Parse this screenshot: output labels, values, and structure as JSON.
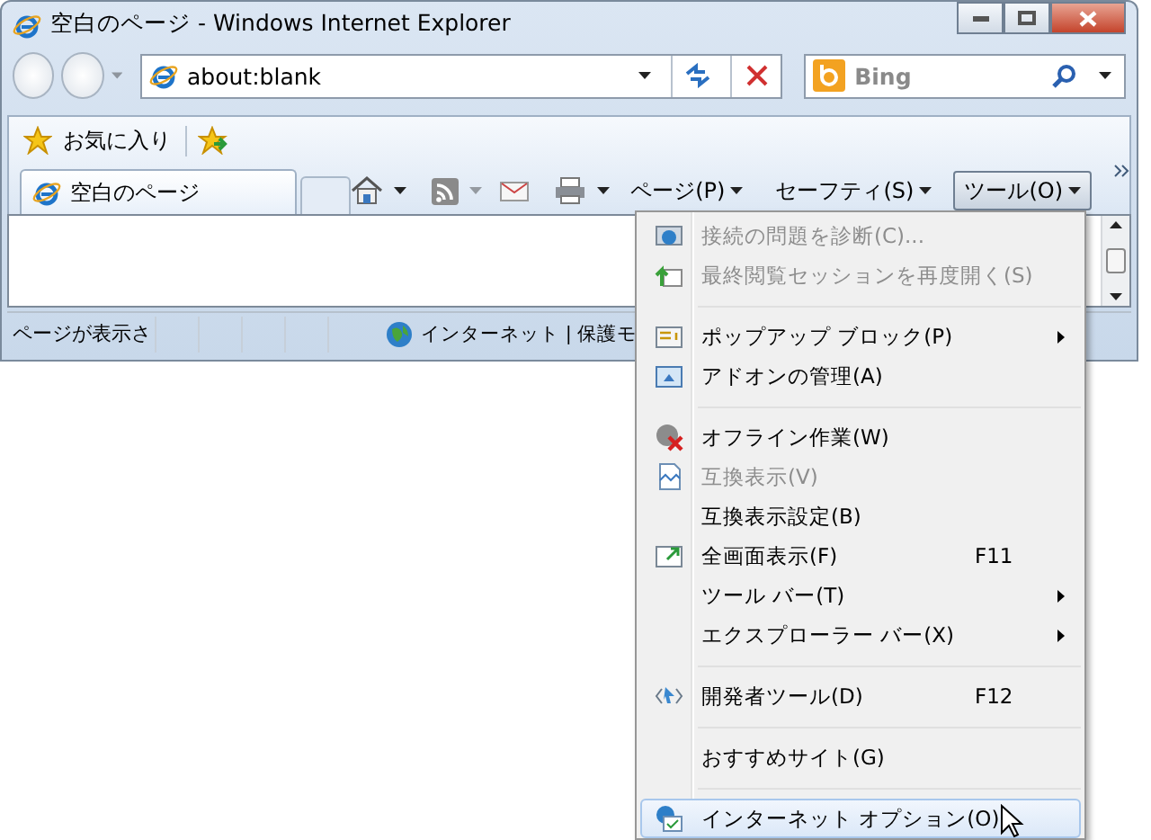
{
  "window": {
    "title": "空白のページ - Windows Internet Explorer"
  },
  "address_bar": {
    "value": "about:blank"
  },
  "search": {
    "placeholder": "Bing"
  },
  "favorites_bar": {
    "label": "お気に入り"
  },
  "tabs": [
    {
      "label": "空白のページ",
      "selected": true
    }
  ],
  "command_bar": [
    {
      "label": "ページ(P)",
      "selected": false
    },
    {
      "label": "セーフティ(S)",
      "selected": false
    },
    {
      "label": "ツール(O)",
      "selected": true
    }
  ],
  "status_bar": {
    "text": "ページが表示さ",
    "zone": "インターネット | 保護モ"
  },
  "menu": {
    "items": [
      {
        "kind": "item",
        "label": "接続の問題を診断(C)...",
        "disabled": true,
        "selected": false,
        "submenu": false
      },
      {
        "kind": "item",
        "label": "最終閲覧セッションを再度開く(S)",
        "disabled": true,
        "selected": false,
        "submenu": false
      },
      {
        "kind": "separator"
      },
      {
        "kind": "item",
        "label": "ポップアップ ブロック(P)",
        "disabled": false,
        "selected": false,
        "submenu": true
      },
      {
        "kind": "item",
        "label": "アドオンの管理(A)",
        "disabled": false,
        "selected": false,
        "submenu": false
      },
      {
        "kind": "separator"
      },
      {
        "kind": "item",
        "label": "オフライン作業(W)",
        "disabled": false,
        "selected": false,
        "submenu": false
      },
      {
        "kind": "item",
        "label": "互換表示(V)",
        "disabled": true,
        "selected": false,
        "submenu": false
      },
      {
        "kind": "item",
        "label": "互換表示設定(B)",
        "disabled": false,
        "selected": false,
        "submenu": false
      },
      {
        "kind": "item",
        "label": "全画面表示(F)",
        "shortcut": "F11",
        "disabled": false,
        "selected": false,
        "submenu": false
      },
      {
        "kind": "item",
        "label": "ツール バー(T)",
        "disabled": false,
        "selected": false,
        "submenu": true
      },
      {
        "kind": "item",
        "label": "エクスプローラー バー(X)",
        "disabled": false,
        "selected": false,
        "submenu": true
      },
      {
        "kind": "separator"
      },
      {
        "kind": "item",
        "label": "開発者ツール(D)",
        "shortcut": "F12",
        "disabled": false,
        "selected": false,
        "submenu": false
      },
      {
        "kind": "separator"
      },
      {
        "kind": "item",
        "label": "おすすめサイト(G)",
        "disabled": false,
        "selected": false,
        "submenu": false
      },
      {
        "kind": "separator"
      },
      {
        "kind": "item",
        "label": "インターネット オプション(O)",
        "disabled": false,
        "selected": true,
        "submenu": false
      }
    ]
  }
}
